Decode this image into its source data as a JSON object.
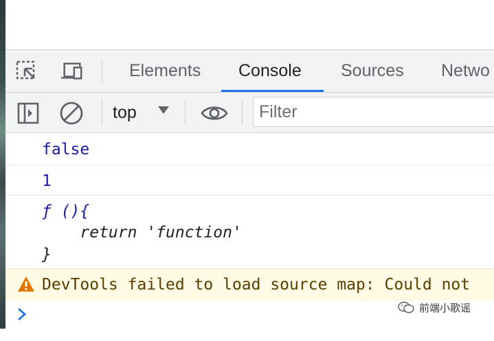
{
  "devtools": {
    "tabs": [
      {
        "label": "Elements"
      },
      {
        "label": "Console"
      },
      {
        "label": "Sources"
      },
      {
        "label": "Netwo"
      }
    ],
    "toolbar_icons": {
      "inspect": "inspect-element-icon",
      "device": "device-toolbar-icon"
    }
  },
  "console_toolbar": {
    "context": "top",
    "filter_placeholder": "Filter"
  },
  "console": {
    "messages": [
      {
        "type": "value",
        "text": "false"
      },
      {
        "type": "value",
        "text": "1"
      },
      {
        "type": "function",
        "lines": [
          "ƒ (){",
          "    return 'function'",
          "}"
        ]
      },
      {
        "type": "warning",
        "text": "DevTools failed to load source map: Could not"
      }
    ],
    "prompt_symbol": "›"
  },
  "watermark": {
    "text": "前端小歌谣"
  },
  "colors": {
    "accent": "#1a73e8",
    "value": "#1a1aa6",
    "warning_bg": "#fffbe5",
    "warning_text": "#5c3c00",
    "warning_icon": "#e37400"
  }
}
